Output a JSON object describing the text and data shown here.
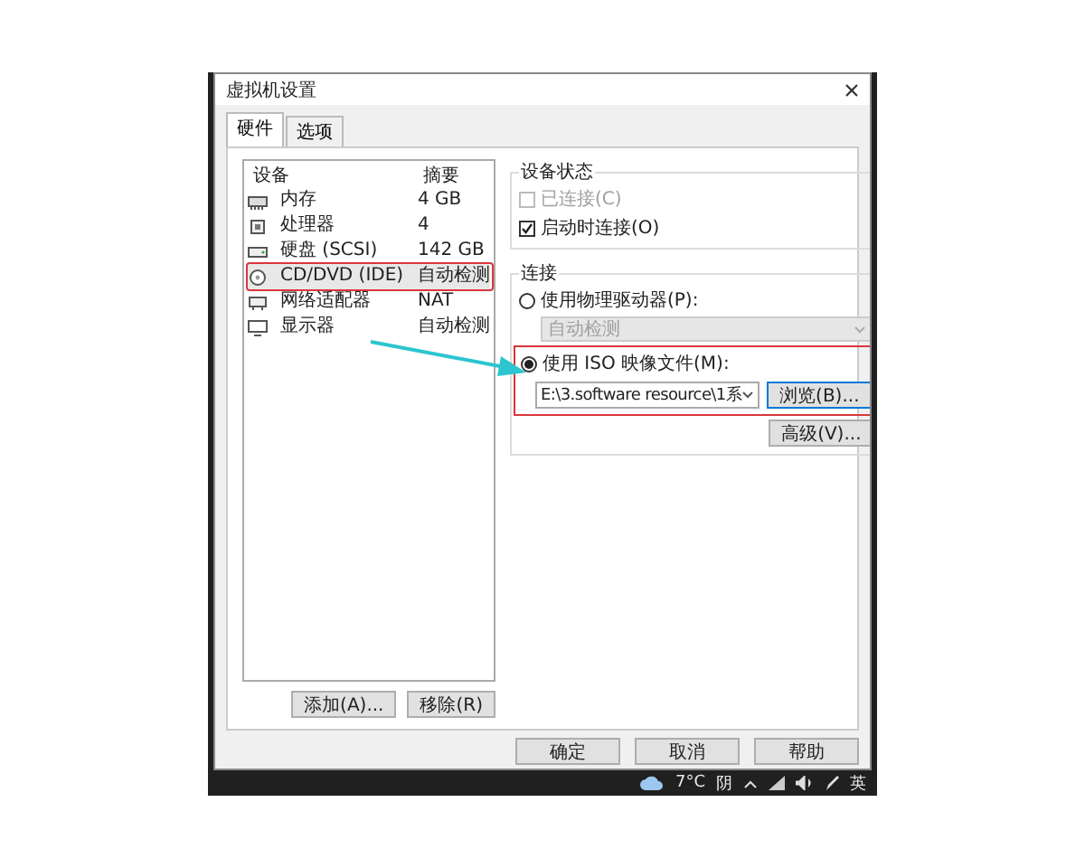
{
  "window": {
    "title": "虚拟机设置"
  },
  "tabs": [
    {
      "label": "硬件",
      "selected": true
    },
    {
      "label": "选项",
      "selected": false
    }
  ],
  "device_list": {
    "columns": [
      "设备",
      "摘要"
    ],
    "rows": [
      {
        "kind": "memory",
        "device": "内存",
        "summary": "4 GB",
        "selected": false,
        "annotated": false
      },
      {
        "kind": "cpu",
        "device": "处理器",
        "summary": "4",
        "selected": false,
        "annotated": false
      },
      {
        "kind": "disk",
        "device": "硬盘 (SCSI)",
        "summary": "142 GB",
        "selected": false,
        "annotated": false
      },
      {
        "kind": "cdrom",
        "device": "CD/DVD (IDE)",
        "summary": "自动检测",
        "selected": true,
        "annotated": true
      },
      {
        "kind": "network",
        "device": "网络适配器",
        "summary": "NAT",
        "selected": false,
        "annotated": false
      },
      {
        "kind": "display",
        "device": "显示器",
        "summary": "自动检测",
        "selected": false,
        "annotated": false
      }
    ]
  },
  "list_buttons": [
    "添加(A)...",
    "移除(R)"
  ],
  "device_status": {
    "title": "设备状态",
    "options": [
      {
        "label": "已连接(C)",
        "checked": false,
        "disabled": true
      },
      {
        "label": "启动时连接(O)",
        "checked": true,
        "disabled": false
      }
    ]
  },
  "connection": {
    "title": "连接",
    "options": [
      {
        "kind": "physical",
        "label": "使用物理驱动器(P):",
        "selected": false
      },
      {
        "kind": "iso",
        "label": "使用 ISO 映像文件(M):",
        "selected": true
      }
    ],
    "drive_select": {
      "value": "自动检测",
      "disabled": true
    },
    "iso_path": {
      "value": "E:\\3.software resource\\1系"
    },
    "browse_button": "浏览(B)...",
    "advanced_button": "高级(V)..."
  },
  "dialog_buttons": [
    "确定",
    "取消",
    "帮助"
  ],
  "taskbar": {
    "temperature": "7°C",
    "weather": "阴",
    "language": "英"
  }
}
